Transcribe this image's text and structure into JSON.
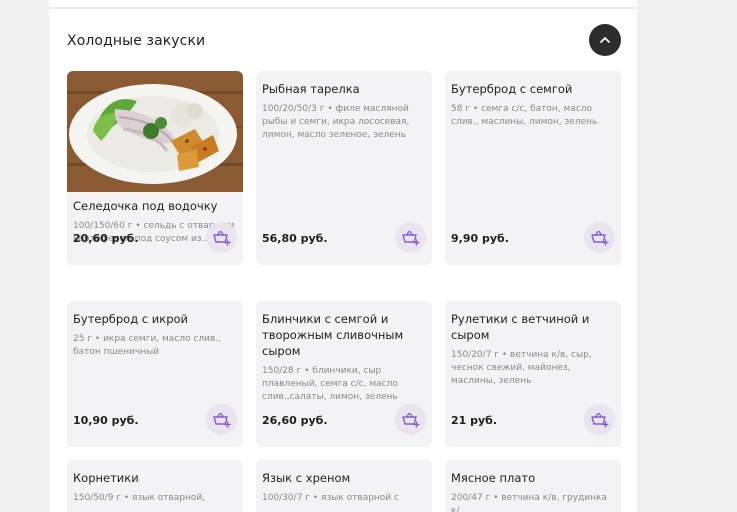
{
  "section": {
    "title": "Холодные закуски"
  },
  "colors": {
    "accent": "#8a5cc8",
    "card_bg": "#f3f2f4",
    "cart_bg": "#e9e4f0",
    "dark_button": "#2c2c2c"
  },
  "products": [
    {
      "name": "Селедочка под водочку",
      "desc": "100/150/60 г • сельдь с отварным картофелем под соусом из...",
      "price": "20,60 руб.",
      "has_image": true
    },
    {
      "name": "Рыбная тарелка",
      "desc": "100/20/50/3 г • филе масляной рыбы и семги, икра лососевая, лимон, масло зеленое, зелень",
      "price": "56,80 руб.",
      "has_image": false
    },
    {
      "name": "Бутерброд с семгой",
      "desc": "58 г • семга с/с, батон, масло слив., маслины, лимон, зелень",
      "price": "9,90 руб.",
      "has_image": false
    },
    {
      "name": "Бутерброд с икрой",
      "desc": "25 г • икра семги, масло слив., батон пшеничный",
      "price": "10,90 руб.",
      "has_image": false
    },
    {
      "name": "Блинчики с семгой и творожным сливочным сыром",
      "desc": "150/28 г • блинчики, сыр плавленый, семга с/с, масло слив.,салаты, лимон, зелень",
      "price": "26,60 руб.",
      "has_image": false
    },
    {
      "name": "Рулетики с ветчиной и сыром",
      "desc": "150/20/7 г • ветчина к/в, сыр, чеснок свежий, майонез, маслины, зелень",
      "price": "21 руб.",
      "has_image": false
    },
    {
      "name": "Корнетики",
      "desc": "150/50/9 г • язык отварной,",
      "price": "",
      "has_image": false
    },
    {
      "name": "Язык с хреном",
      "desc": "100/30/7 г • язык отварной с",
      "price": "",
      "has_image": false
    },
    {
      "name": "Мясное плато",
      "desc": "200/47 г • ветчина к/в, грудинка к/",
      "price": "",
      "has_image": false
    }
  ],
  "icons": {
    "collapse": "chevron-up-icon",
    "cart": "add-to-cart-icon"
  }
}
